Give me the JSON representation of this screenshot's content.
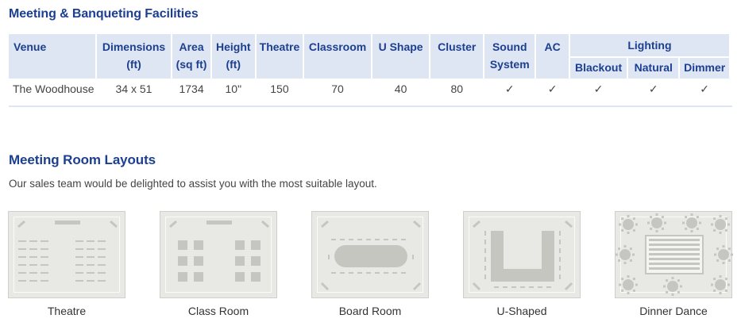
{
  "facilities": {
    "title": "Meeting & Banqueting Facilities",
    "headers": {
      "venue": "Venue",
      "dimensions": "Dimensions (ft)",
      "area": "Area (sq ft)",
      "height": "Height (ft)",
      "theatre": "Theatre",
      "classroom": "Classroom",
      "ushape": "U Shape",
      "cluster": "Cluster",
      "sound": "Sound System",
      "ac": "AC",
      "lighting": "Lighting",
      "blackout": "Blackout",
      "natural": "Natural",
      "dimmer": "Dimmer"
    },
    "rows": [
      {
        "venue": "The Woodhouse",
        "dimensions": "34 x 51",
        "area": "1734",
        "height": "10\"",
        "theatre": "150",
        "classroom": "70",
        "ushape": "40",
        "cluster": "80",
        "sound": "✓",
        "ac": "✓",
        "blackout": "✓",
        "natural": "✓",
        "dimmer": "✓"
      }
    ]
  },
  "layouts": {
    "title": "Meeting Room Layouts",
    "subtitle": "Our sales team would be delighted to assist you with the most suitable layout.",
    "items": [
      {
        "label": "Theatre",
        "icon": "theatre-layout-icon"
      },
      {
        "label": "Class Room",
        "icon": "classroom-layout-icon"
      },
      {
        "label": "Board Room",
        "icon": "boardroom-layout-icon"
      },
      {
        "label": "U-Shaped",
        "icon": "u-shaped-layout-icon"
      },
      {
        "label": "Dinner Dance",
        "icon": "dinner-dance-layout-icon"
      }
    ]
  },
  "colors": {
    "heading": "#1d3f8f",
    "header_bg": "#dfe6f3",
    "card_bg": "#e8e8e4",
    "diagram": "#c6c6c1"
  }
}
